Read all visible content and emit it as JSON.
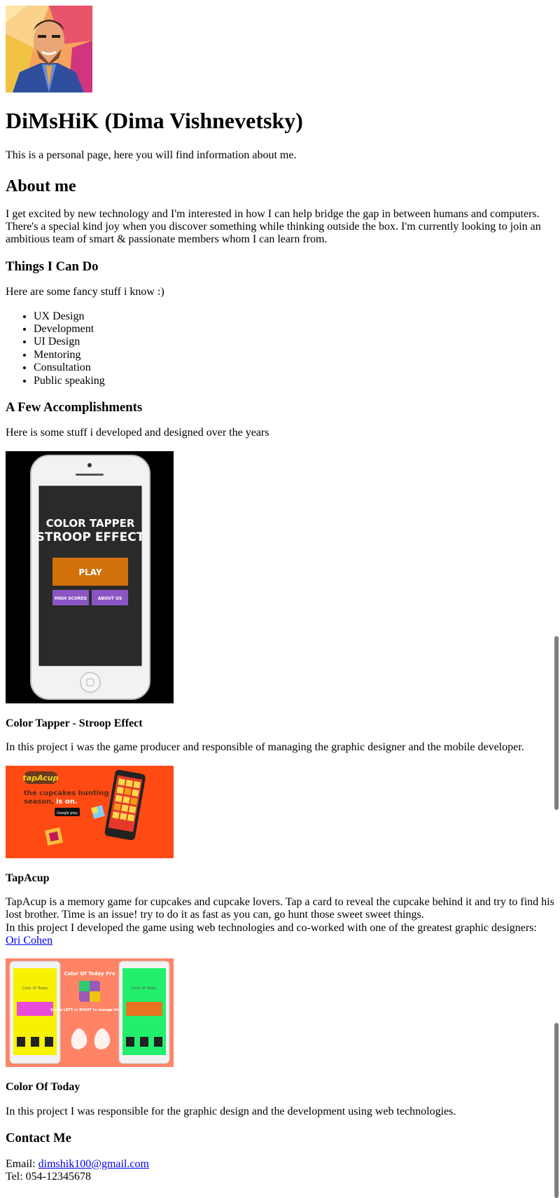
{
  "header": {
    "title": "DiMsHiK (Dima Vishnevetsky)",
    "intro": "This is a personal page, here you will find information about me."
  },
  "about": {
    "heading": "About me",
    "text": "I get excited by new technology and I'm interested in how I can help bridge the gap in between humans and computers. There's a special kind joy when you discover something while thinking outside the box. I'm currently looking to join an ambitious team of smart & passionate members whom I can learn from."
  },
  "skills": {
    "heading": "Things I Can Do",
    "intro": "Here are some fancy stuff i know :)",
    "items": [
      "UX Design",
      "Development",
      "UI Design",
      "Mentoring",
      "Consultation",
      "Public speaking"
    ]
  },
  "accomplishments": {
    "heading": "A Few Accomplishments",
    "intro": "Here is some stuff i developed and designed over the years",
    "projects": [
      {
        "title": "Color Tapper - Stroop Effect",
        "description": "In this project i was the game producer and responsible of managing the graphic designer and the mobile developer.",
        "image": {
          "line1": "COLOR TAPPER",
          "line2": "STROOP EFFECT",
          "play": "PLAY",
          "btn1": "HIGH SCORES",
          "btn2": "ABOUT US"
        }
      },
      {
        "title": "TapAcup",
        "description_line1": "TapAcup is a memory game for cupcakes and cupcake lovers. Tap a card to reveal the cupcake behind it and try to find his lost brother. Time is an issue! try to do it as fast as you can, go hunt those sweet sweet things.",
        "description_line2": "In this project I developed the game using web technologies and co-worked with one of the greatest graphic designers: ",
        "link_text": "Ori Cohen",
        "image": {
          "logo": "tapAcup",
          "tagline1": "the cupcakes hunting",
          "tagline2": "season,",
          "tagline3": "is on.",
          "store": "Google play"
        }
      },
      {
        "title": "Color Of Today",
        "description": "In this project I was responsible for the graphic design and the development using web technologies.",
        "image": {
          "title": "Color Of Today Pro",
          "hint": "Swipe LEFT or RIGHT to change the Day",
          "phone_label": "Color Of Today"
        }
      }
    ]
  },
  "contact": {
    "heading": "Contact Me",
    "email_label": "Email: ",
    "email": "dimshik100@gmail.com",
    "tel": "Tel: 054-12345678"
  },
  "colors": {
    "link": "#0000ee",
    "tapacup_bg": "#ff4a14",
    "colortoday_bg": "#ff8466",
    "tapper_button": "#d2700a",
    "tapper_sub": "#8b55c4"
  }
}
